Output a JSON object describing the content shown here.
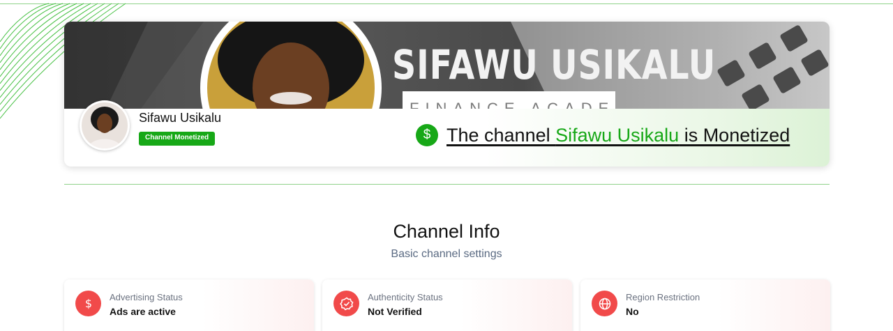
{
  "banner": {
    "brand_name": "SIFAWU USIKALU",
    "brand_sub": "FINANCE ACADEMY"
  },
  "channel": {
    "name": "Sifawu Usikalu",
    "badge": "Channel Monetized",
    "status_prefix": "The channel ",
    "status_name": "Sifawu Usikalu",
    "status_suffix": " is Monetized",
    "dollar_symbol": "$"
  },
  "section": {
    "title": "Channel Info",
    "subtitle": "Basic channel settings"
  },
  "stats": [
    {
      "label": "Advertising Status",
      "value": "Ads are active",
      "icon": "dollar-icon"
    },
    {
      "label": "Authenticity Status",
      "value": "Not Verified",
      "icon": "verified-badge-icon"
    },
    {
      "label": "Region Restriction",
      "value": "No",
      "icon": "globe-icon"
    }
  ],
  "colors": {
    "accent_green": "#17a817",
    "stat_icon_red": "#f14a4a",
    "divider_green": "#8fd28a"
  }
}
